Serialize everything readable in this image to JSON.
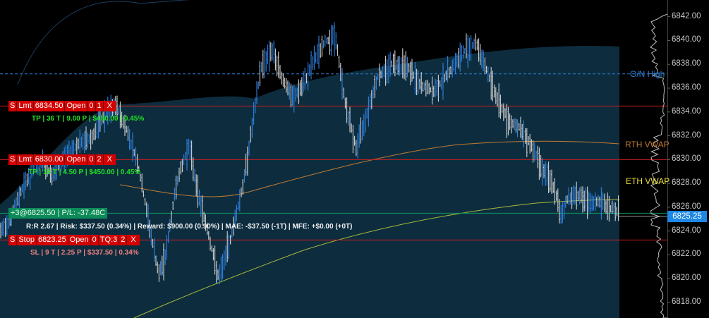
{
  "axis": {
    "price_min": 6816.7,
    "price_max": 6843.4,
    "ticks": [
      "6842.00",
      "6840.00",
      "6838.00",
      "6836.00",
      "6834.00",
      "6832.00",
      "6830.00",
      "6828.00",
      "6826.00",
      "6824.00",
      "6822.00",
      "6820.00",
      "6818.00"
    ]
  },
  "current_price": "6825.25",
  "levels": {
    "on_high": {
      "label": "O/N High",
      "price": 6837.2,
      "color": "#2d7fd0"
    },
    "tp1": {
      "price": 6834.5,
      "color": "#cc1f1f"
    },
    "tp2": {
      "price": 6830.0,
      "color": "#cc1f1f"
    },
    "entry": {
      "price": 6825.5,
      "color": "#0f9a63"
    },
    "stop": {
      "price": 6823.25,
      "color": "#cc1f1f"
    }
  },
  "vwap": {
    "rth_label": "RTH VWAP",
    "eth_label": "ETH VWAP",
    "rth_color": "#c07a30",
    "eth_color": "#a8b837"
  },
  "orders": {
    "tp1": [
      "S",
      "Lmt",
      "6834.50",
      "Open",
      "0",
      "1",
      "X"
    ],
    "tp2": [
      "S",
      "Lmt",
      "6830.00",
      "Open",
      "0",
      "2",
      "X"
    ],
    "stop": [
      "S",
      "Stop",
      "6823.25",
      "Open",
      "0",
      "TQ:3",
      "2",
      "X"
    ],
    "position": "+3@6825.50 | P/L: -37.48C"
  },
  "info": {
    "tp1": "TP | 36 T | 9.00 P | $450.00 | 0.45%",
    "tp2": "TP | 18 T | 4.50 P | $450.00 | 0.45%",
    "rr": "R:R 2.67 | Risk: $337.50 (0.34%) | Reward: $900.00 (0.90%) | MAE: -$37.50 (-1T) | MFE: +$0.00 (+0T)",
    "sl": "SL | 9 T | 2.25 P | $337.50 | 0.34%"
  },
  "colors": {
    "up": "#2f80e0",
    "down": "#d0d0d0",
    "cloud": "#0e3246"
  }
}
